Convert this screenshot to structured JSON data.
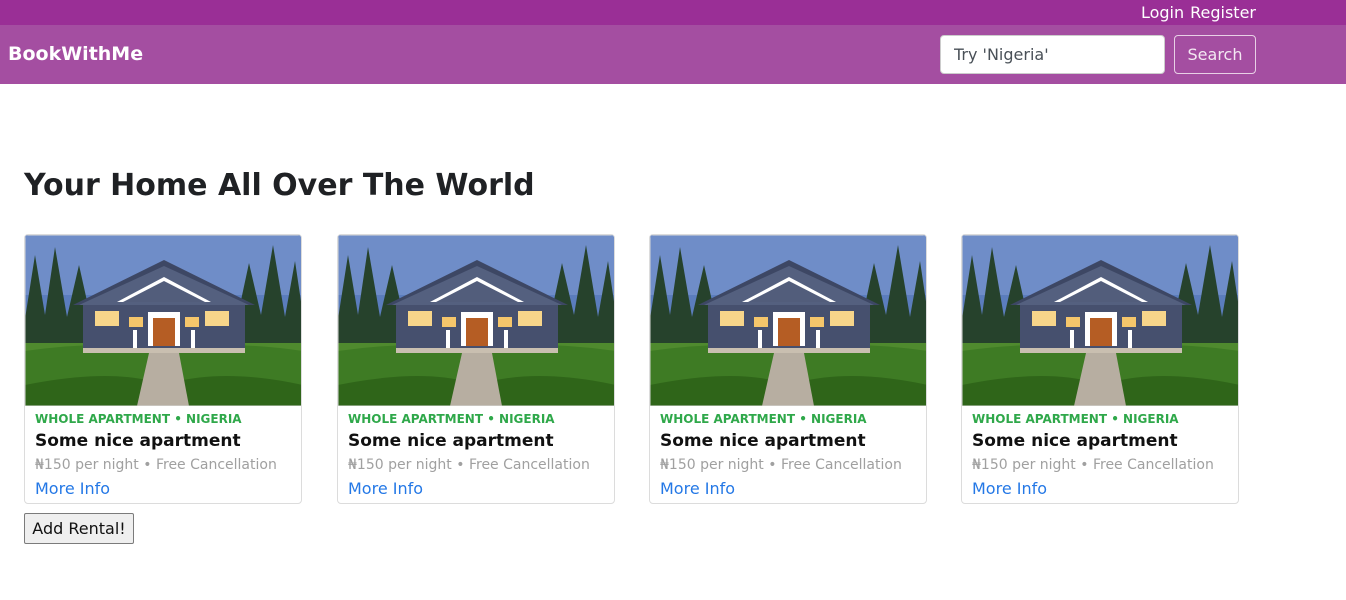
{
  "top_links": {
    "login": "Login",
    "register": "Register"
  },
  "navbar": {
    "brand": "BookWithMe",
    "search_placeholder": "Try 'Nigeria'",
    "search_button": "Search"
  },
  "page": {
    "title": "Your Home All Over The World"
  },
  "rentals": [
    {
      "meta": "WHOLE APARTMENT • NIGERIA",
      "title": "Some nice apartment",
      "price": "₦150 per night • Free Cancellation",
      "link": "More Info"
    },
    {
      "meta": "WHOLE APARTMENT • NIGERIA",
      "title": "Some nice apartment",
      "price": "₦150 per night • Free Cancellation",
      "link": "More Info"
    },
    {
      "meta": "WHOLE APARTMENT • NIGERIA",
      "title": "Some nice apartment",
      "price": "₦150 per night • Free Cancellation",
      "link": "More Info"
    },
    {
      "meta": "WHOLE APARTMENT • NIGERIA",
      "title": "Some nice apartment",
      "price": "₦150 per night • Free Cancellation",
      "link": "More Info"
    }
  ],
  "actions": {
    "add_rental": "Add Rental!"
  }
}
